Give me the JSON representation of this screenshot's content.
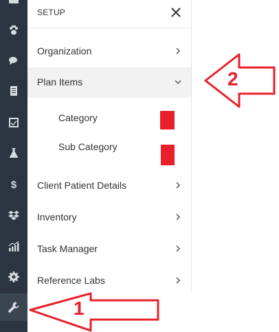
{
  "rail": {
    "icons": [
      {
        "name": "calendar-icon"
      },
      {
        "name": "paw-icon"
      },
      {
        "name": "chat-icon"
      },
      {
        "name": "document-icon"
      },
      {
        "name": "checkbox-icon"
      },
      {
        "name": "flask-icon"
      },
      {
        "name": "dollar-icon"
      },
      {
        "name": "dropbox-icon"
      },
      {
        "name": "chart-icon"
      },
      {
        "name": "gear-icon"
      },
      {
        "name": "wrench-icon"
      }
    ],
    "dollar_glyph": "$"
  },
  "panel": {
    "title": "SETUP",
    "items": [
      {
        "label": "Organization",
        "expanded": false
      },
      {
        "label": "Plan Items",
        "expanded": true
      },
      {
        "label": "Client Patient Details",
        "expanded": false
      },
      {
        "label": "Inventory",
        "expanded": false
      },
      {
        "label": "Task Manager",
        "expanded": false
      },
      {
        "label": "Reference Labs",
        "expanded": false
      }
    ],
    "sub_items": [
      {
        "label": "Category"
      },
      {
        "label": "Sub Category"
      }
    ]
  },
  "annotations": {
    "arrow_1": "1",
    "arrow_2": "2"
  },
  "colors": {
    "rail_bg": "#2b3440",
    "annotation_red": "#e8202a",
    "expanded_bg": "#f2f2f2"
  }
}
